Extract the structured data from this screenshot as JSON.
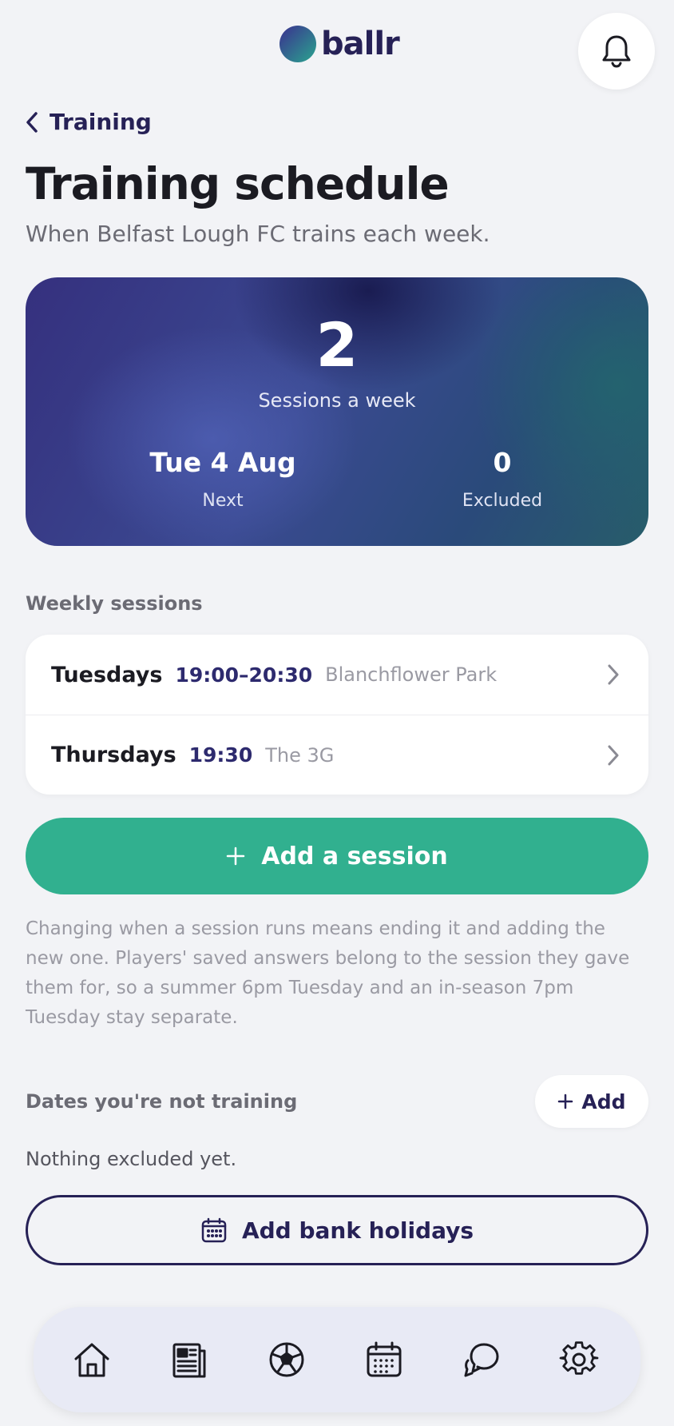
{
  "header": {
    "logo_text": "ballr",
    "notifications_icon": "bell-icon"
  },
  "nav": {
    "back_label": "Training",
    "back_icon": "chevron-left-icon"
  },
  "page": {
    "title": "Training schedule",
    "subtitle": "When Belfast Lough FC trains each week."
  },
  "summary": {
    "sessions_count": "2",
    "sessions_label": "Sessions a week",
    "next_value": "Tue 4 Aug",
    "next_label": "Next",
    "excluded_value": "0",
    "excluded_label": "Excluded"
  },
  "weekly": {
    "heading": "Weekly sessions",
    "sessions": [
      {
        "day": "Tuesdays",
        "time": "19:00–20:30",
        "place": "Blanchflower Park"
      },
      {
        "day": "Thursdays",
        "time": "19:30",
        "place": "The 3G"
      }
    ],
    "add_label": "Add a session",
    "note": "Changing when a session runs means ending it and adding the new one. Players' saved answers belong to the session they gave them for, so a summer 6pm Tuesday and an in-season 7pm Tuesday stay separate."
  },
  "exclusions": {
    "heading": "Dates you're not training",
    "add_label": "Add",
    "empty_text": "Nothing excluded yet.",
    "bank_holidays_label": "Add bank holidays"
  },
  "bottom_nav": {
    "items": [
      "home-icon",
      "news-icon",
      "football-icon",
      "calendar-icon",
      "chat-icon",
      "settings-icon"
    ]
  },
  "colors": {
    "accent_green": "#31b08f",
    "brand_navy": "#262156",
    "background": "#f2f3f6"
  }
}
